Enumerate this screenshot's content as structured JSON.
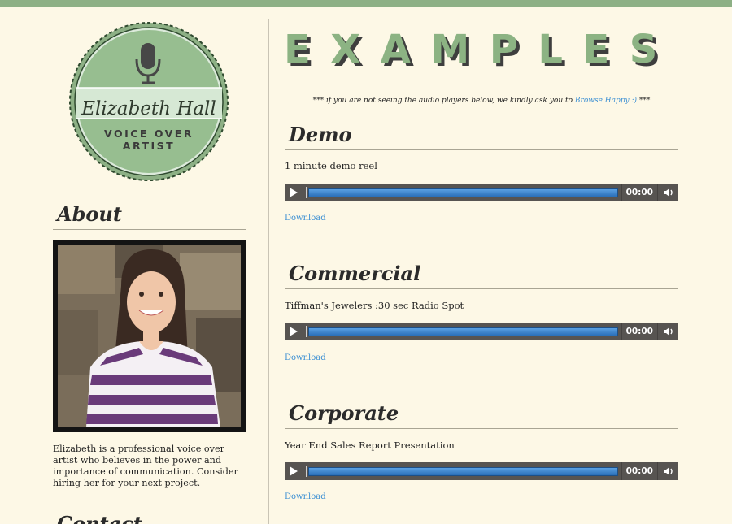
{
  "colors": {
    "accent": "#8db085",
    "link": "#3b8fd3",
    "background": "#fdf8e6"
  },
  "logo": {
    "name": "Elizabeth Hall",
    "subtitle_line1": "VOICE OVER",
    "subtitle_line2": "ARTIST",
    "icon": "microphone-icon"
  },
  "about": {
    "heading": "About",
    "text": "Elizabeth is a professional voice over artist who believes in the power and importance of communication. Consider hiring her for your next project."
  },
  "contact": {
    "heading": "Contact"
  },
  "main": {
    "title": "EXAMPLES",
    "notice_prefix": "*** if you are not seeing the audio players below, we kindly ask you to",
    "notice_link": "Browse Happy :)",
    "notice_suffix": "***",
    "sections": [
      {
        "heading": "Demo",
        "description": "1 minute demo reel",
        "time": "00:00",
        "download": "Download"
      },
      {
        "heading": "Commercial",
        "description": "Tiffman's Jewelers :30 sec Radio Spot",
        "time": "00:00",
        "download": "Download"
      },
      {
        "heading": "Corporate",
        "description": "Year End Sales Report Presentation",
        "time": "00:00",
        "download": "Download"
      }
    ]
  }
}
